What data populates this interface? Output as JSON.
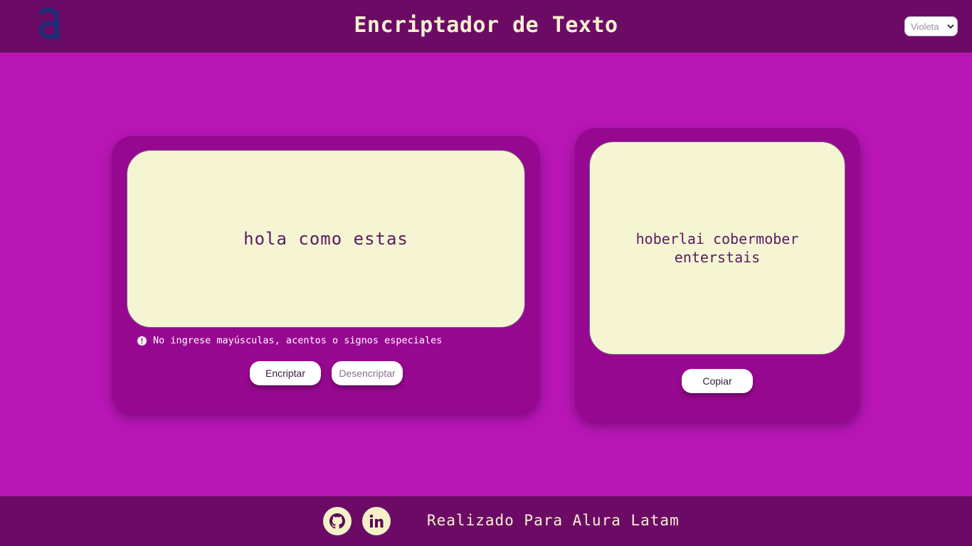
{
  "header": {
    "logo_icon": "alura-logo-icon",
    "title": "Encriptador de Texto",
    "theme_select_value": "Violeta"
  },
  "encrypt_panel": {
    "input_text": "hola como estas",
    "warning_icon": "exclamation-circle-icon",
    "warning_text": "No ingrese mayúsculas, acentos o signos especiales",
    "encrypt_label": "Encriptar",
    "decrypt_label": "Desencriptar"
  },
  "result_panel": {
    "output_text": "hoberlai cobermober enterstais",
    "copy_label": "Copiar"
  },
  "footer": {
    "github_icon": "github-icon",
    "linkedin_icon": "linkedin-icon",
    "credit_text": "Realizado Para Alura Latam"
  },
  "colors": {
    "background": "#b716b5",
    "header_footer": "#6c0b66",
    "card": "#970890",
    "textbox": "#f5f5d4",
    "text_accent": "#f7f1cf"
  }
}
